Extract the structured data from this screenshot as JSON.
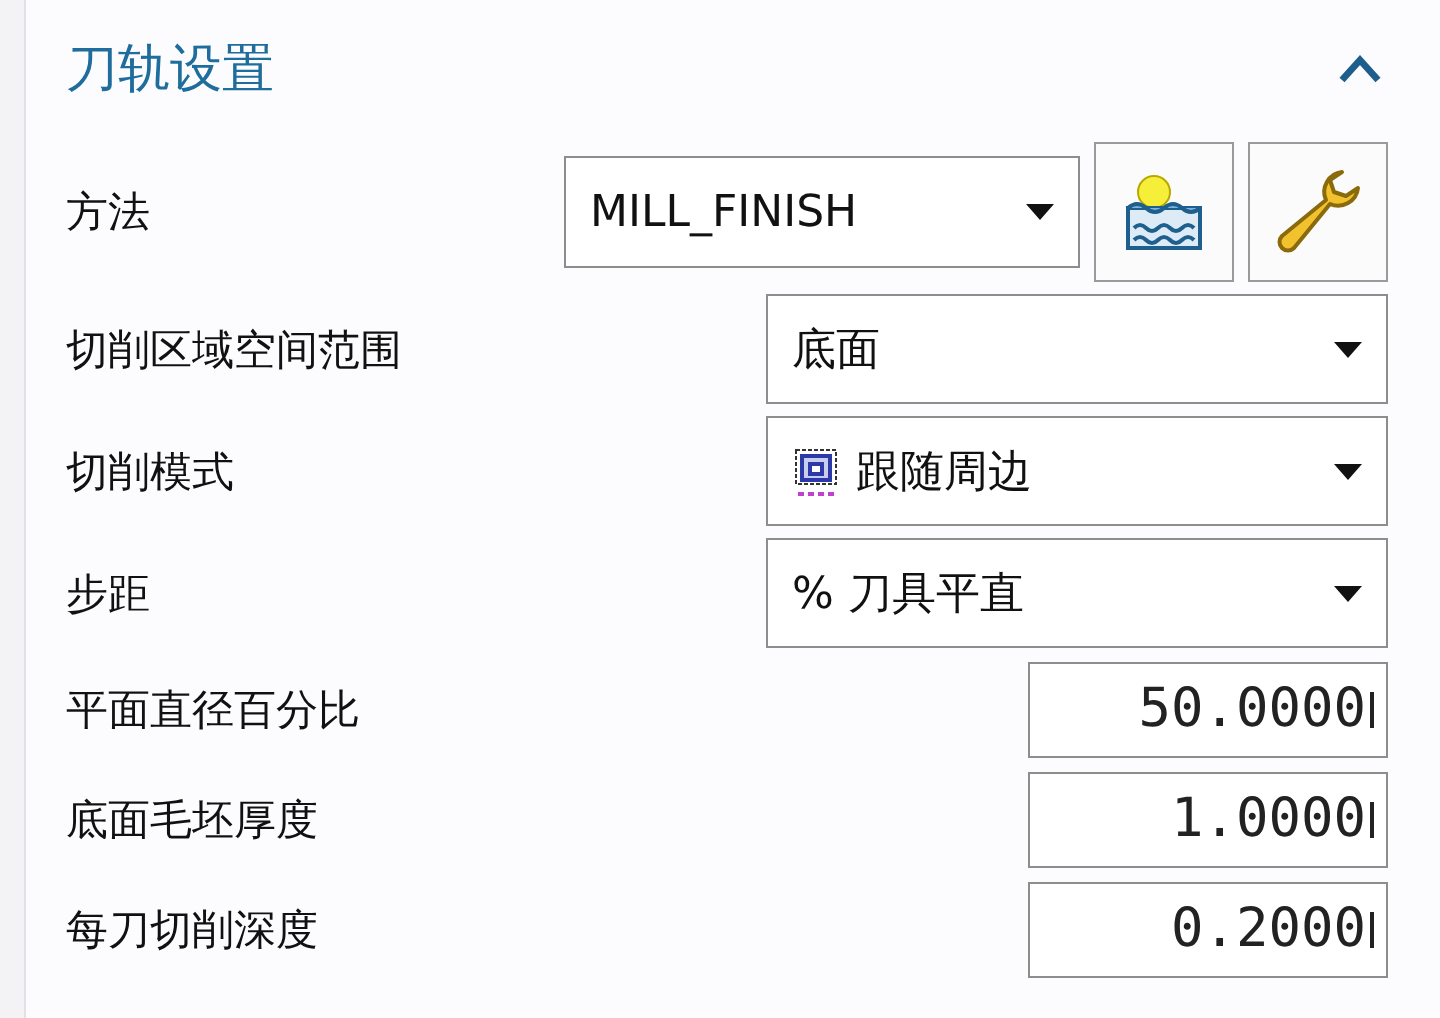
{
  "section": {
    "title": "刀轨设置",
    "expanded": true
  },
  "method": {
    "label": "方法",
    "value": "MILL_FINISH"
  },
  "rows": [
    {
      "kind": "dropdown",
      "label": "切削区域空间范围",
      "value": "底面"
    },
    {
      "kind": "icon-dropdown",
      "label": "切削模式",
      "value": "跟随周边"
    },
    {
      "kind": "dropdown",
      "label": "步距",
      "value": "% 刀具平直"
    },
    {
      "kind": "number",
      "label": "平面直径百分比",
      "value": "50.0000"
    },
    {
      "kind": "number",
      "label": "底面毛坯厚度",
      "value": "1.0000"
    },
    {
      "kind": "number",
      "label": "每刀切削深度",
      "value": "0.2000"
    }
  ]
}
